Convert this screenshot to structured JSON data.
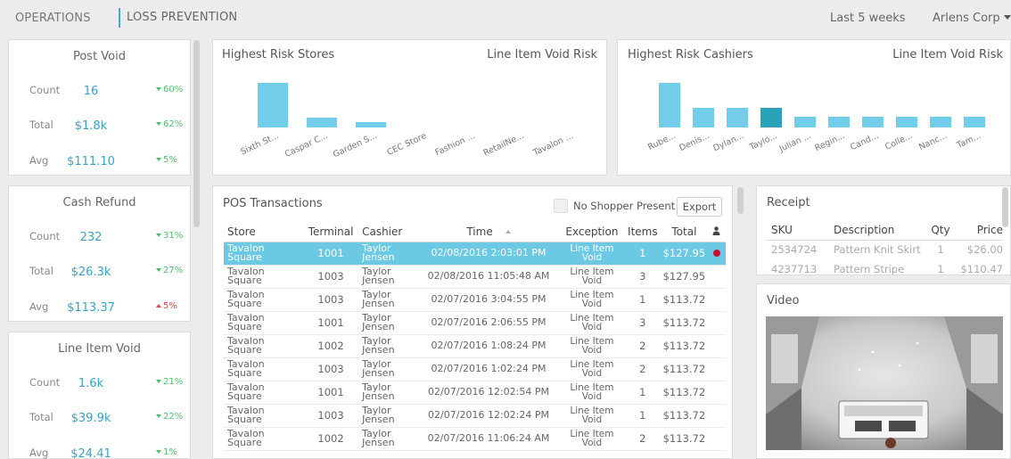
{
  "nav": {
    "tab1": "OPERATIONS",
    "tab2": "LOSS PREVENTION",
    "period": "Last 5 weeks",
    "company": "Arlens Corp"
  },
  "stats": [
    {
      "title": "Post Void",
      "rows": [
        {
          "label": "Count",
          "value": "16",
          "change": "60%",
          "dir": "down"
        },
        {
          "label": "Total",
          "value": "$1.8k",
          "change": "62%",
          "dir": "down"
        },
        {
          "label": "Avg",
          "value": "$111.10",
          "change": "5%",
          "dir": "down"
        }
      ]
    },
    {
      "title": "Cash Refund",
      "rows": [
        {
          "label": "Count",
          "value": "232",
          "change": "31%",
          "dir": "down"
        },
        {
          "label": "Total",
          "value": "$26.3k",
          "change": "27%",
          "dir": "down"
        },
        {
          "label": "Avg",
          "value": "$113.37",
          "change": "5%",
          "dir": "up"
        }
      ]
    },
    {
      "title": "Line Item Void",
      "rows": [
        {
          "label": "Count",
          "value": "1.6k",
          "change": "21%",
          "dir": "down"
        },
        {
          "label": "Total",
          "value": "$39.9k",
          "change": "22%",
          "dir": "down"
        },
        {
          "label": "Avg",
          "value": "$24.41",
          "change": "1%",
          "dir": "down"
        }
      ]
    }
  ],
  "stores_panel": {
    "title": "Highest Risk Stores",
    "subtitle": "Line Item Void Risk",
    "bars": [
      {
        "label": "Sixth St...",
        "value": 100
      },
      {
        "label": "Caspar C...",
        "value": 22
      },
      {
        "label": "Garden S...",
        "value": 12
      },
      {
        "label": "CEC Store",
        "value": 0
      },
      {
        "label": "Fashion ...",
        "value": 0
      },
      {
        "label": "RetailNe...",
        "value": 0
      },
      {
        "label": "Tavalon ...",
        "value": 0
      }
    ]
  },
  "cashiers_panel": {
    "title": "Highest Risk Cashiers",
    "subtitle": "Line Item Void Risk",
    "selected": "Taylo...",
    "bars": [
      {
        "label": "Rube...",
        "value": 100
      },
      {
        "label": "Denis...",
        "value": 45
      },
      {
        "label": "Dylan...",
        "value": 45
      },
      {
        "label": "Taylo...",
        "value": 45
      },
      {
        "label": "Julian ...",
        "value": 25
      },
      {
        "label": "Regin...",
        "value": 25
      },
      {
        "label": "Cand...",
        "value": 25
      },
      {
        "label": "Colle...",
        "value": 25
      },
      {
        "label": "Nanc...",
        "value": 25
      },
      {
        "label": "Tam...",
        "value": 25
      }
    ]
  },
  "transactions": {
    "title": "POS Transactions",
    "checkbox_label": "No Shopper Present",
    "export_label": "Export",
    "columns": [
      "Store",
      "Terminal",
      "Cashier",
      "Time",
      "Exception",
      "Items",
      "Total"
    ],
    "rows": [
      {
        "store": "Tavalon Square",
        "terminal": "1001",
        "cashier": "Taylor Jensen",
        "time": "02/08/2016 2:03:01 PM",
        "exception": "Line Item Void",
        "items": "1",
        "total": "$127.95",
        "flag": true,
        "selected": true
      },
      {
        "store": "Tavalon Square",
        "terminal": "1003",
        "cashier": "Taylor Jensen",
        "time": "02/08/2016 11:05:48 AM",
        "exception": "Line Item Void",
        "items": "3",
        "total": "$127.95",
        "flag": false,
        "selected": false
      },
      {
        "store": "Tavalon Square",
        "terminal": "1003",
        "cashier": "Taylor Jensen",
        "time": "02/07/2016 3:04:55 PM",
        "exception": "Line Item Void",
        "items": "1",
        "total": "$113.72",
        "flag": false,
        "selected": false
      },
      {
        "store": "Tavalon Square",
        "terminal": "1001",
        "cashier": "Taylor Jensen",
        "time": "02/07/2016 2:06:55 PM",
        "exception": "Line Item Void",
        "items": "3",
        "total": "$113.72",
        "flag": false,
        "selected": false
      },
      {
        "store": "Tavalon Square",
        "terminal": "1002",
        "cashier": "Taylor Jensen",
        "time": "02/07/2016 1:08:24 PM",
        "exception": "Line Item Void",
        "items": "2",
        "total": "$113.72",
        "flag": false,
        "selected": false
      },
      {
        "store": "Tavalon Square",
        "terminal": "1003",
        "cashier": "Taylor Jensen",
        "time": "02/07/2016 1:02:24 PM",
        "exception": "Line Item Void",
        "items": "2",
        "total": "$113.72",
        "flag": false,
        "selected": false
      },
      {
        "store": "Tavalon Square",
        "terminal": "1001",
        "cashier": "Taylor Jensen",
        "time": "02/07/2016 12:02:54 PM",
        "exception": "Line Item Void",
        "items": "1",
        "total": "$113.72",
        "flag": false,
        "selected": false
      },
      {
        "store": "Tavalon Square",
        "terminal": "1003",
        "cashier": "Taylor Jensen",
        "time": "02/07/2016 12:02:24 PM",
        "exception": "Line Item Void",
        "items": "1",
        "total": "$113.72",
        "flag": false,
        "selected": false
      },
      {
        "store": "Tavalon Square",
        "terminal": "1002",
        "cashier": "Taylor Jensen",
        "time": "02/07/2016 11:06:24 AM",
        "exception": "Line Item Void",
        "items": "2",
        "total": "$113.72",
        "flag": false,
        "selected": false
      }
    ]
  },
  "receipt": {
    "title": "Receipt",
    "columns": [
      "SKU",
      "Description",
      "Qty",
      "Price"
    ],
    "rows": [
      {
        "sku": "2534724",
        "description": "Pattern Knit Skirt",
        "qty": "1",
        "price": "$26.00"
      },
      {
        "sku": "4237713",
        "description": "Pattern Stripe",
        "qty": "1",
        "price": "$110.47"
      }
    ]
  },
  "video": {
    "title": "Video"
  },
  "colors": {
    "accent": "#3aaccc",
    "bar": "#72cde8",
    "bar_selected": "#2aa3b8",
    "down": "#4dbf6a",
    "up": "#e0474c",
    "flag": "#c8102e"
  }
}
